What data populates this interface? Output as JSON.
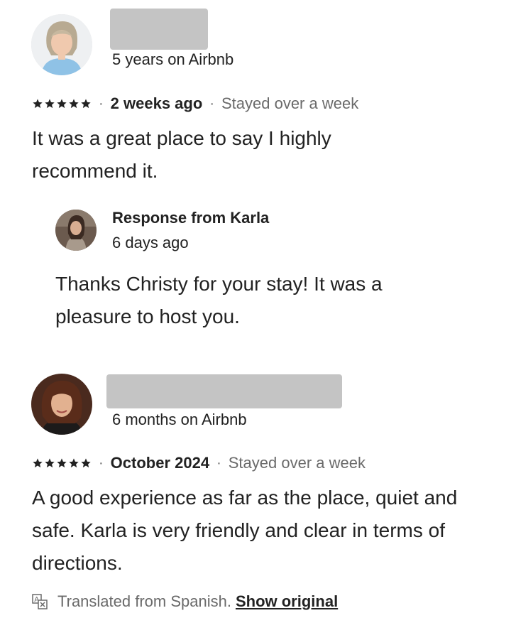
{
  "reviews": [
    {
      "tenure": "5 years on Airbnb",
      "rating": 5,
      "date": "2 weeks ago",
      "stay": "Stayed over a week",
      "text": "It was a great place to say I highly recommend it.",
      "response": {
        "title": "Response from Karla",
        "date": "6 days ago",
        "text": "Thanks Christy for your stay! It was a pleasure to host you."
      }
    },
    {
      "tenure": "6 months on Airbnb",
      "rating": 5,
      "date": "October 2024",
      "stay": "Stayed over a week",
      "text": "A good experience as far as the place, quiet and safe. Karla is very friendly and clear in terms of directions.",
      "translation": {
        "note": "Translated from Spanish.",
        "link": "Show original"
      }
    }
  ],
  "separator": "·",
  "colors": {
    "text": "#222222",
    "muted": "#6a6a6a",
    "redaction": "#c4c4c4"
  }
}
